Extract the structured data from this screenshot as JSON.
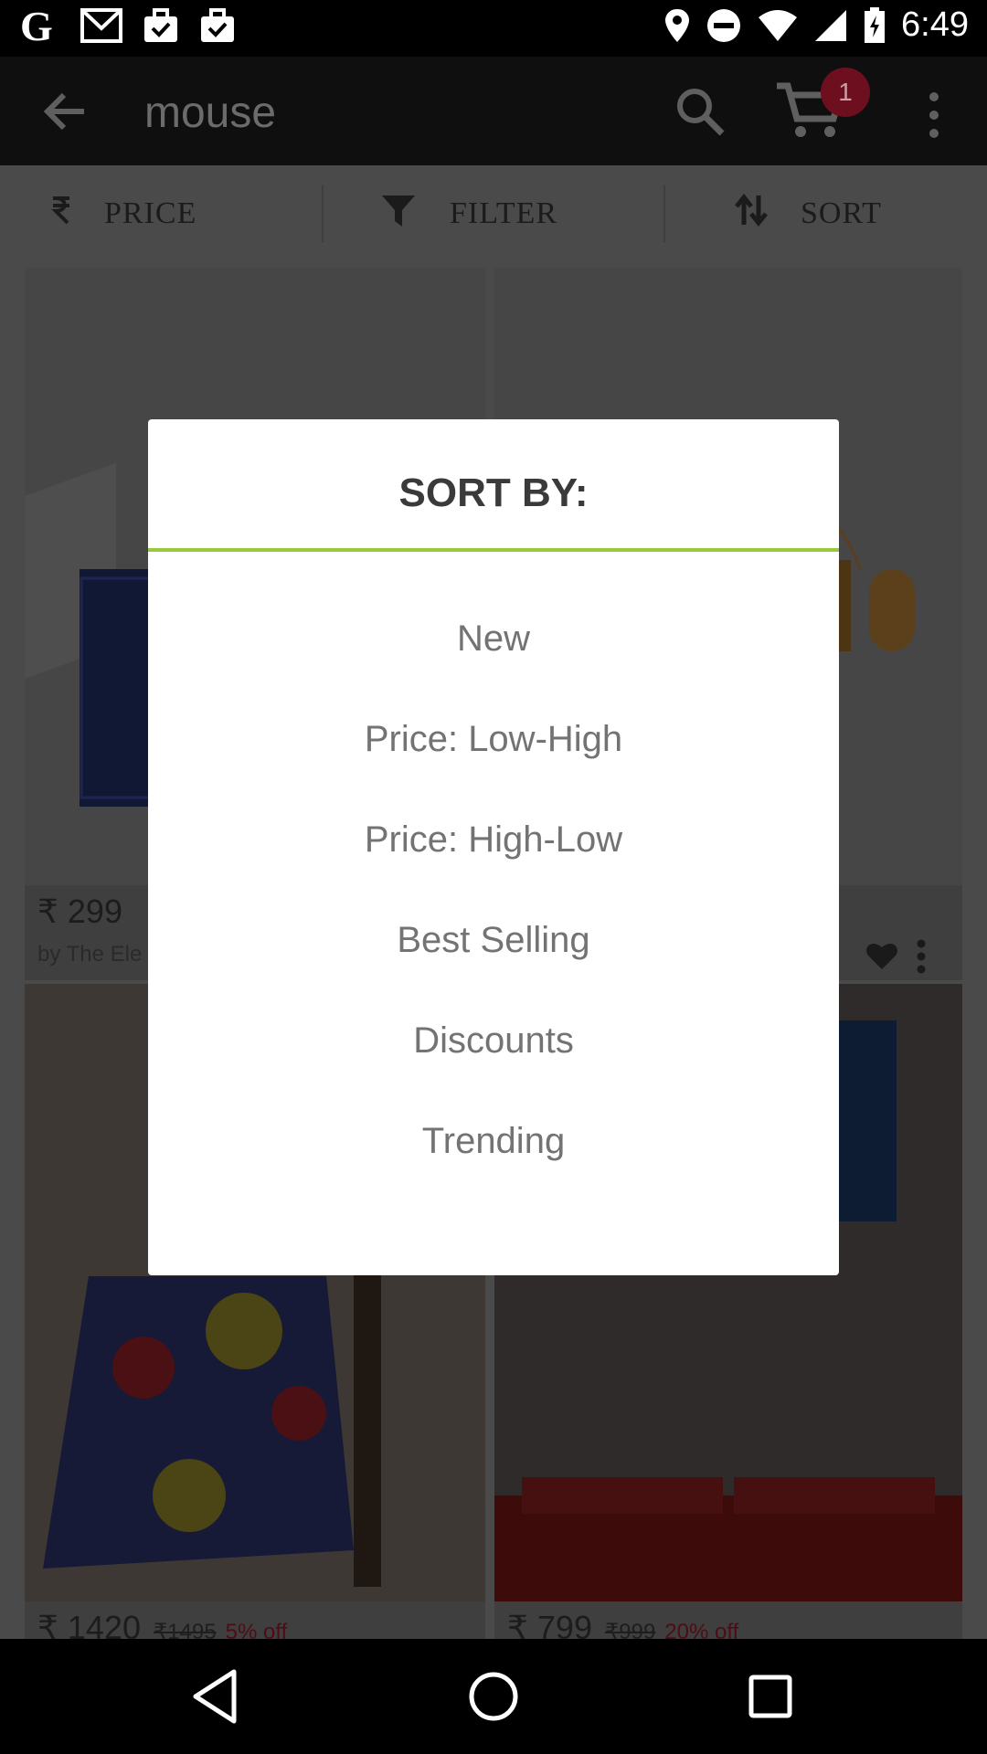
{
  "status_bar": {
    "time": "6:49",
    "left_icons": [
      "google-icon",
      "gmail-icon",
      "briefcase-check-icon",
      "briefcase-check-icon"
    ],
    "right_icons": [
      "location-icon",
      "do-not-disturb-icon",
      "wifi-icon",
      "signal-icon",
      "battery-charging-icon"
    ]
  },
  "app_bar": {
    "title": "mouse",
    "cart_count": "1"
  },
  "tabs": [
    {
      "label": "PRICE",
      "icon": "rupee-icon"
    },
    {
      "label": "FILTER",
      "icon": "funnel-icon"
    },
    {
      "label": "SORT",
      "icon": "sort-arrows-icon"
    }
  ],
  "products": [
    {
      "price": "₹ 299",
      "seller": "by The Ele",
      "mrp": "",
      "off": ""
    },
    {
      "price": "",
      "seller": "",
      "mrp": "",
      "off": ""
    },
    {
      "price": "₹ 1420",
      "mrp": "₹1495",
      "off": "5% off",
      "seller": ""
    },
    {
      "price": "₹ 799",
      "mrp": "₹999",
      "off": "20% off",
      "seller": ""
    }
  ],
  "dialog": {
    "title": "SORT BY:",
    "options": [
      "New",
      "Price: Low-High",
      "Price: High-Low",
      "Best Selling",
      "Discounts",
      "Trending"
    ]
  },
  "colors": {
    "accent": "#98c93c",
    "badge": "#6e0f20",
    "discount": "#4d0c16"
  }
}
